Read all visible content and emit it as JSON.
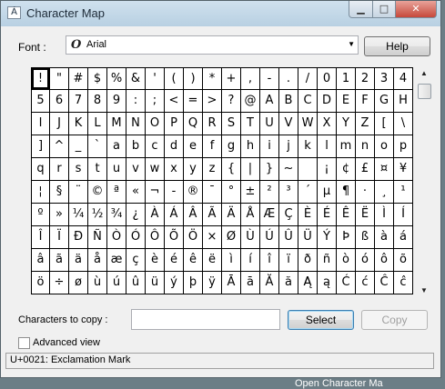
{
  "window": {
    "title": "Character Map",
    "app_icon": "character-map-icon"
  },
  "font_row": {
    "label": "Font :",
    "selected_font": "Arial",
    "font_icon": "opentype-font-icon",
    "help_label": "Help"
  },
  "grid": {
    "rows": [
      [
        "!",
        "\"",
        "#",
        "$",
        "%",
        "&",
        "'",
        "(",
        ")",
        "*",
        "+",
        ",",
        "-",
        ".",
        "/",
        "0",
        "1",
        "2",
        "3",
        "4"
      ],
      [
        "5",
        "6",
        "7",
        "8",
        "9",
        ":",
        ";",
        "<",
        "=",
        ">",
        "?",
        "@",
        "A",
        "B",
        "C",
        "D",
        "E",
        "F",
        "G",
        "H"
      ],
      [
        "I",
        "J",
        "K",
        "L",
        "M",
        "N",
        "O",
        "P",
        "Q",
        "R",
        "S",
        "T",
        "U",
        "V",
        "W",
        "X",
        "Y",
        "Z",
        "[",
        "\\"
      ],
      [
        "]",
        "^",
        "_",
        "`",
        "a",
        "b",
        "c",
        "d",
        "e",
        "f",
        "g",
        "h",
        "i",
        "j",
        "k",
        "l",
        "m",
        "n",
        "o",
        "p"
      ],
      [
        "q",
        "r",
        "s",
        "t",
        "u",
        "v",
        "w",
        "x",
        "y",
        "z",
        "{",
        "|",
        "}",
        "~",
        " ",
        "¡",
        "¢",
        "£",
        "¤",
        "¥"
      ],
      [
        "¦",
        "§",
        "¨",
        "©",
        "ª",
        "«",
        "¬",
        "-",
        "®",
        "¯",
        "°",
        "±",
        "²",
        "³",
        "´",
        "µ",
        "¶",
        "·",
        "¸",
        "¹"
      ],
      [
        "º",
        "»",
        "¼",
        "½",
        "¾",
        "¿",
        "À",
        "Á",
        "Â",
        "Ã",
        "Ä",
        "Å",
        "Æ",
        "Ç",
        "È",
        "É",
        "Ê",
        "Ë",
        "Ì",
        "Í"
      ],
      [
        "Î",
        "Ï",
        "Ð",
        "Ñ",
        "Ò",
        "Ó",
        "Ô",
        "Õ",
        "Ö",
        "×",
        "Ø",
        "Ù",
        "Ú",
        "Û",
        "Ü",
        "Ý",
        "Þ",
        "ß",
        "à",
        "á"
      ],
      [
        "â",
        "ã",
        "ä",
        "å",
        "æ",
        "ç",
        "è",
        "é",
        "ê",
        "ë",
        "ì",
        "í",
        "î",
        "ï",
        "ð",
        "ñ",
        "ò",
        "ó",
        "ô",
        "õ"
      ],
      [
        "ö",
        "÷",
        "ø",
        "ù",
        "ú",
        "û",
        "ü",
        "ý",
        "þ",
        "ÿ",
        "Ā",
        "ā",
        "Ă",
        "ă",
        "Ą",
        "ą",
        "Ć",
        "ć",
        "Ĉ",
        "ĉ"
      ]
    ],
    "selected": [
      0,
      0
    ]
  },
  "copy_row": {
    "label": "Characters to copy :",
    "value": "",
    "select_label": "Select",
    "copy_label": "Copy"
  },
  "advanced": {
    "label": "Advanced view",
    "checked": false
  },
  "status_bar": {
    "text": "U+0021: Exclamation Mark"
  },
  "background": {
    "text": "Open Character Ma"
  },
  "colors": {
    "titlebar": "#c4d9e9",
    "close_button": "#c6483b",
    "select_focus": "#3c7fb1"
  }
}
